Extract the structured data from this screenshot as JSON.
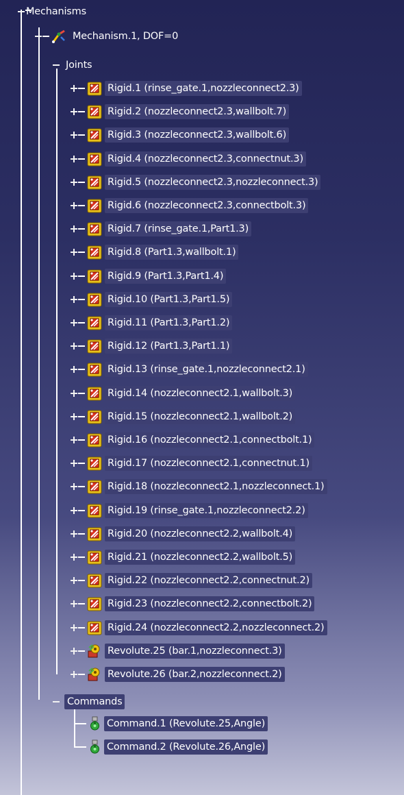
{
  "tree": {
    "root_label": "Mechanisms",
    "mechanism_label": "Mechanism.1, DOF=0",
    "joints_label": "Joints",
    "joints": [
      {
        "label": "Rigid.1 (rinse_gate.1,nozzleconnect2.3)",
        "icon": "rigid-joint-icon"
      },
      {
        "label": "Rigid.2 (nozzleconnect2.3,wallbolt.7)",
        "icon": "rigid-joint-icon"
      },
      {
        "label": "Rigid.3 (nozzleconnect2.3,wallbolt.6)",
        "icon": "rigid-joint-icon"
      },
      {
        "label": "Rigid.4 (nozzleconnect2.3,connectnut.3)",
        "icon": "rigid-joint-icon"
      },
      {
        "label": "Rigid.5 (nozzleconnect2.3,nozzleconnect.3)",
        "icon": "rigid-joint-icon"
      },
      {
        "label": "Rigid.6 (nozzleconnect2.3,connectbolt.3)",
        "icon": "rigid-joint-icon"
      },
      {
        "label": "Rigid.7 (rinse_gate.1,Part1.3)",
        "icon": "rigid-joint-icon"
      },
      {
        "label": "Rigid.8 (Part1.3,wallbolt.1)",
        "icon": "rigid-joint-icon"
      },
      {
        "label": "Rigid.9 (Part1.3,Part1.4)",
        "icon": "rigid-joint-icon"
      },
      {
        "label": "Rigid.10 (Part1.3,Part1.5)",
        "icon": "rigid-joint-icon"
      },
      {
        "label": "Rigid.11 (Part1.3,Part1.2)",
        "icon": "rigid-joint-icon"
      },
      {
        "label": "Rigid.12 (Part1.3,Part1.1)",
        "icon": "rigid-joint-icon"
      },
      {
        "label": "Rigid.13 (rinse_gate.1,nozzleconnect2.1)",
        "icon": "rigid-joint-icon"
      },
      {
        "label": "Rigid.14 (nozzleconnect2.1,wallbolt.3)",
        "icon": "rigid-joint-icon"
      },
      {
        "label": "Rigid.15 (nozzleconnect2.1,wallbolt.2)",
        "icon": "rigid-joint-icon"
      },
      {
        "label": "Rigid.16 (nozzleconnect2.1,connectbolt.1)",
        "icon": "rigid-joint-icon"
      },
      {
        "label": "Rigid.17 (nozzleconnect2.1,connectnut.1)",
        "icon": "rigid-joint-icon"
      },
      {
        "label": "Rigid.18 (nozzleconnect2.1,nozzleconnect.1)",
        "icon": "rigid-joint-icon"
      },
      {
        "label": "Rigid.19 (rinse_gate.1,nozzleconnect2.2)",
        "icon": "rigid-joint-icon"
      },
      {
        "label": "Rigid.20 (nozzleconnect2.2,wallbolt.4)",
        "icon": "rigid-joint-icon"
      },
      {
        "label": "Rigid.21 (nozzleconnect2.2,wallbolt.5)",
        "icon": "rigid-joint-icon"
      },
      {
        "label": "Rigid.22 (nozzleconnect2.2,connectnut.2)",
        "icon": "rigid-joint-icon"
      },
      {
        "label": "Rigid.23 (nozzleconnect2.2,connectbolt.2)",
        "icon": "rigid-joint-icon"
      },
      {
        "label": "Rigid.24 (nozzleconnect2.2,nozzleconnect.2)",
        "icon": "rigid-joint-icon"
      },
      {
        "label": "Revolute.25 (bar.1,nozzleconnect.3)",
        "icon": "revolute-joint-icon"
      },
      {
        "label": "Revolute.26 (bar.2,nozzleconnect.2)",
        "icon": "revolute-joint-icon"
      }
    ],
    "commands_label": "Commands",
    "commands": [
      {
        "label": "Command.1 (Revolute.25,Angle)",
        "icon": "command-icon"
      },
      {
        "label": "Command.2 (Revolute.26,Angle)",
        "icon": "command-icon"
      }
    ]
  }
}
